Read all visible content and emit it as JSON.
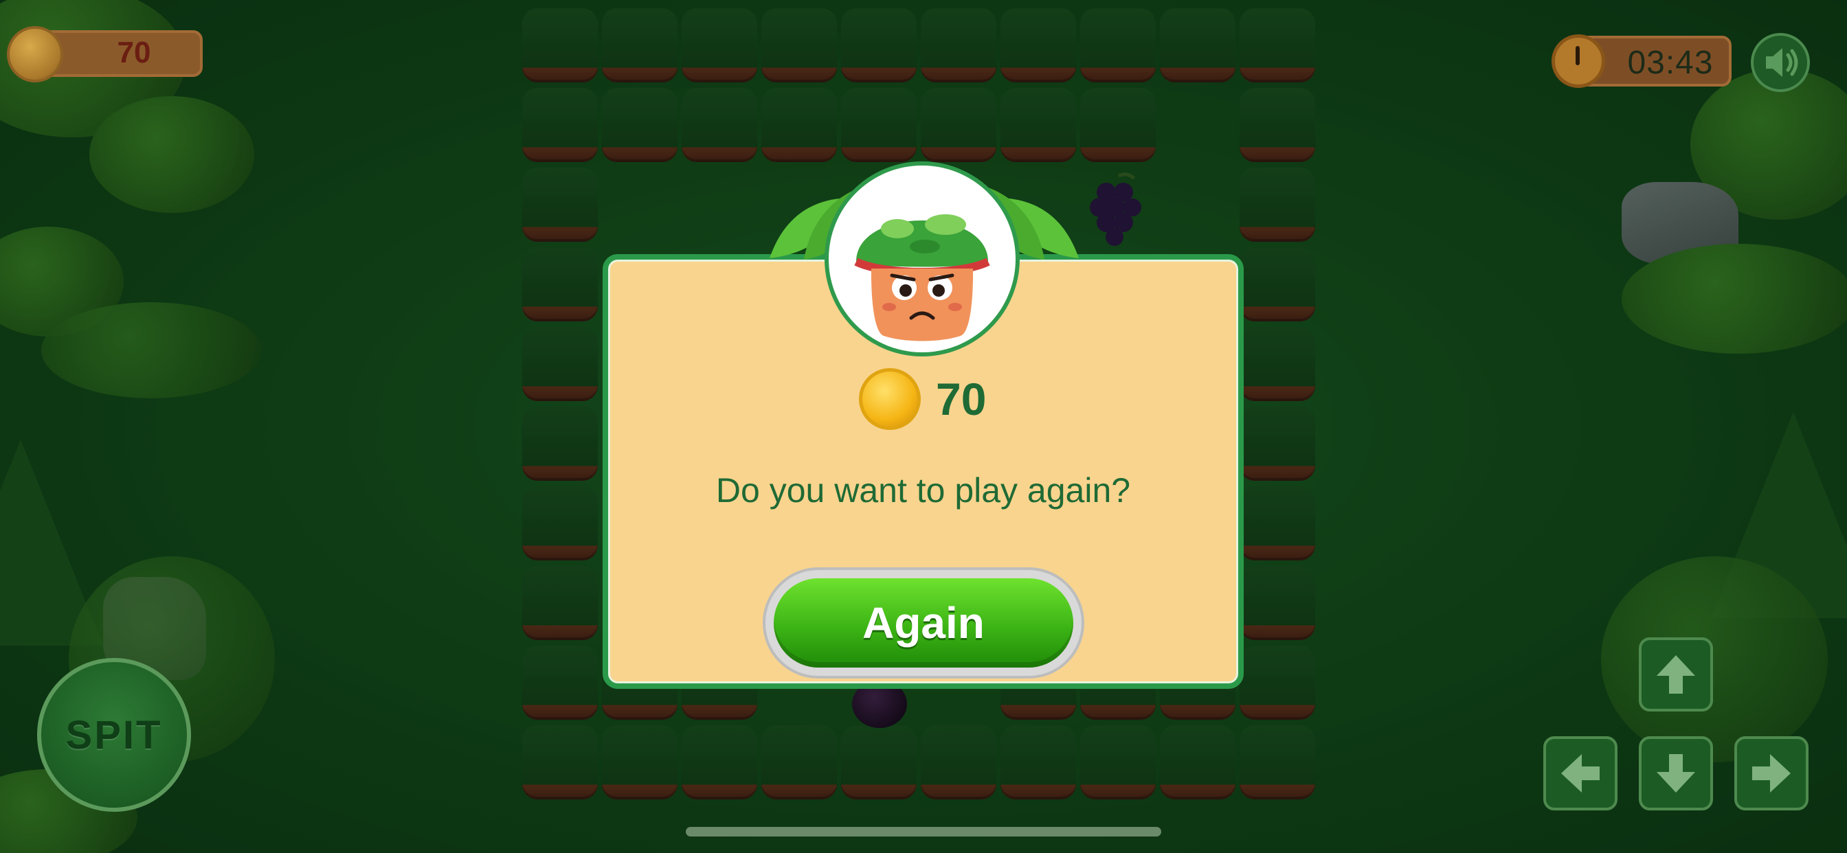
{
  "hud": {
    "coins": "70",
    "timer": "03:43",
    "sound_icon": "speaker-icon",
    "coin_icon": "coin-icon",
    "clock_icon": "stopwatch-icon"
  },
  "dialog": {
    "reward_amount": "70",
    "question": "Do you want to play again?",
    "again_label": "Again",
    "avatar_icon": "sad-mushroom-icon"
  },
  "controls": {
    "spit_label": "SPIT",
    "up_icon": "arrow-up-icon",
    "left_icon": "arrow-left-icon",
    "down_icon": "arrow-down-icon",
    "right_icon": "arrow-right-icon"
  },
  "colors": {
    "dialog_bg": "#f9d48e",
    "dialog_border": "#2a9a4a",
    "text_green": "#1f6a35",
    "button_green": "#3cb415"
  }
}
